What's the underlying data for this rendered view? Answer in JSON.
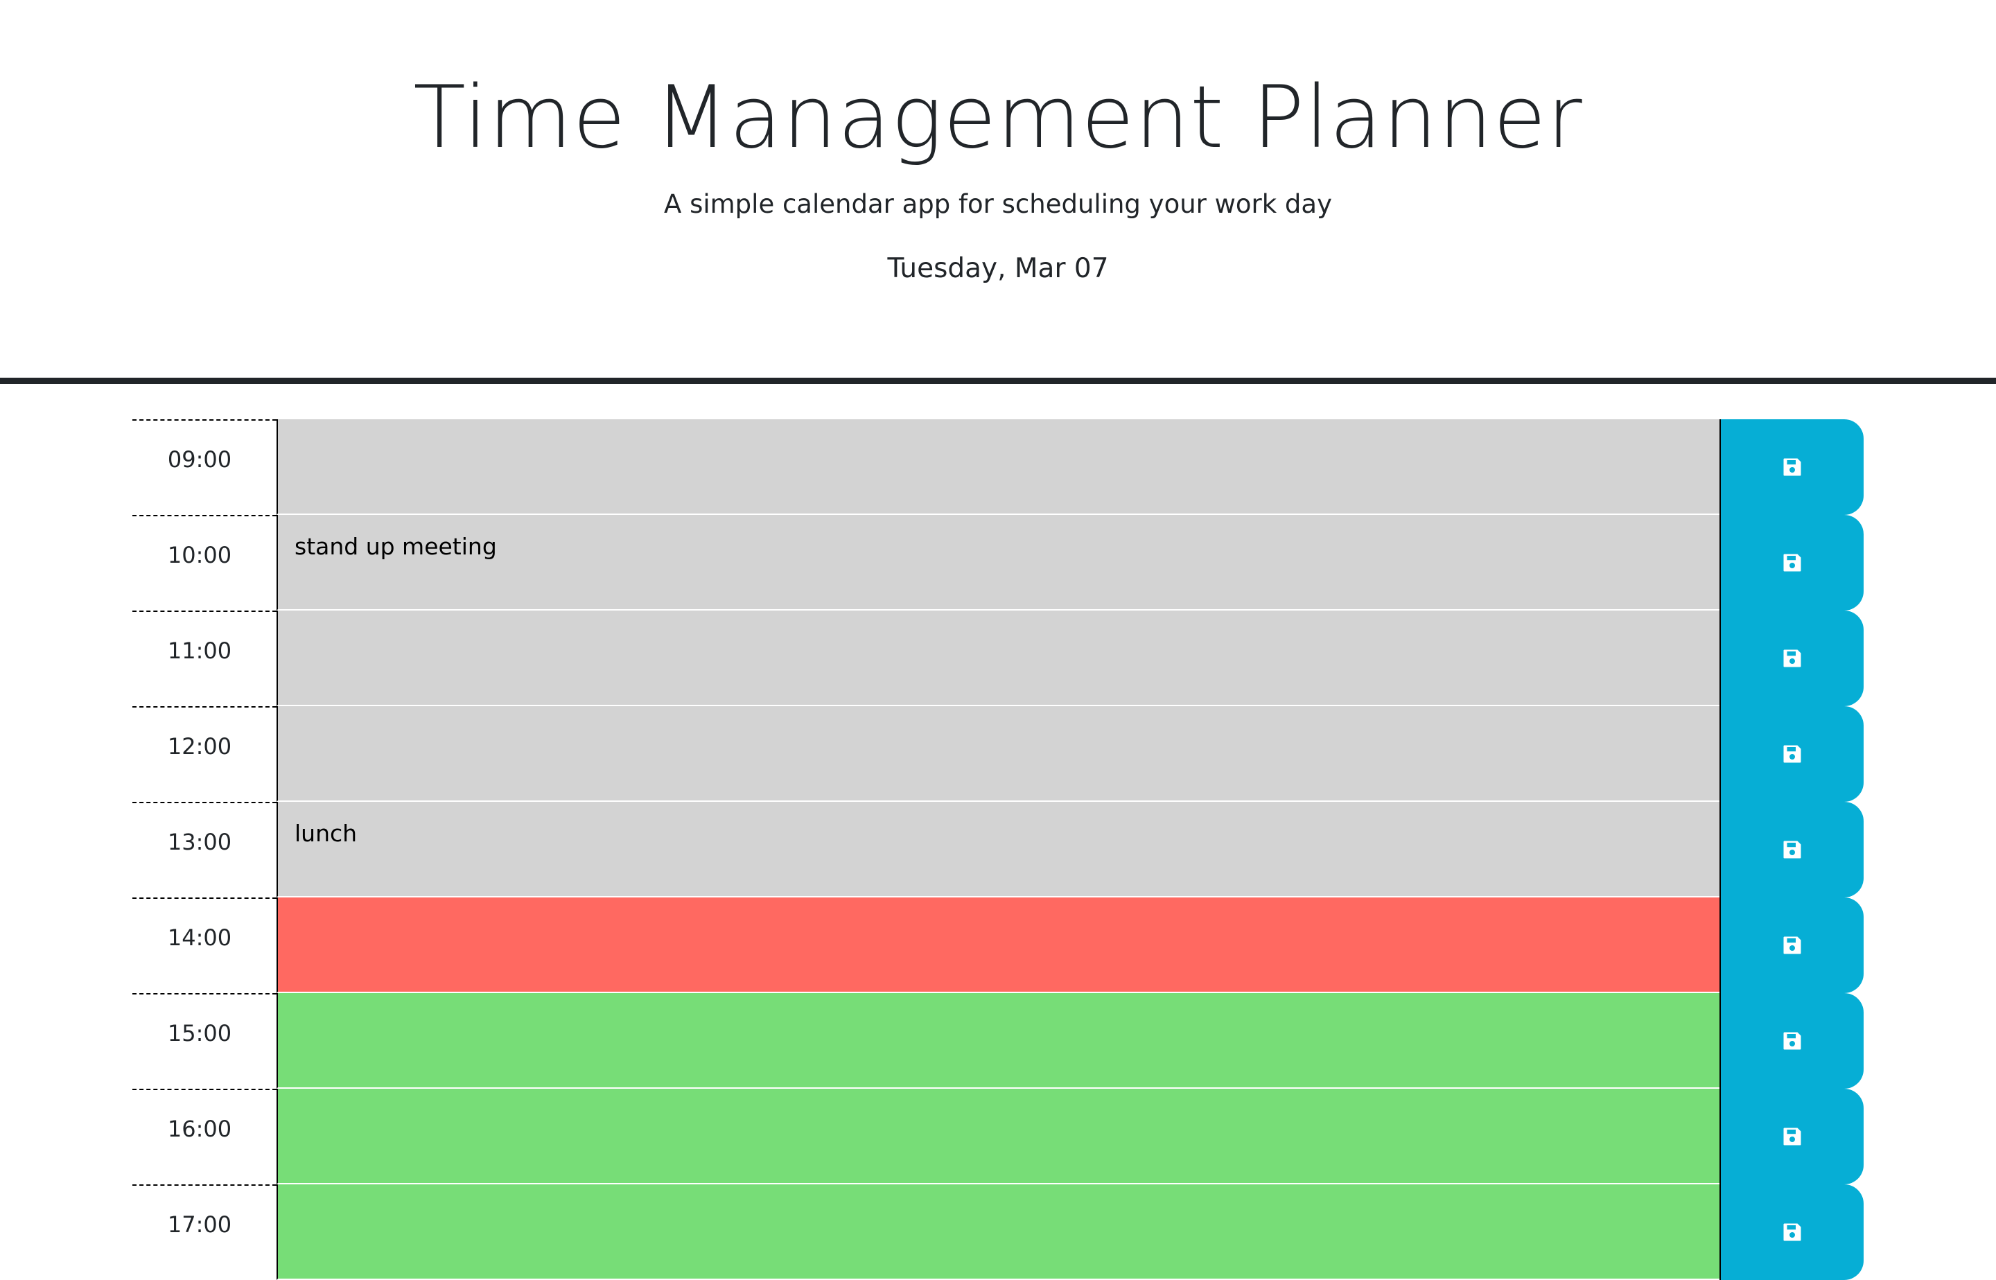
{
  "header": {
    "title": "Time Management Planner",
    "subtitle": "A simple calendar app for scheduling your work day",
    "current_day": "Tuesday, Mar 07"
  },
  "colors": {
    "past": "#d3d3d3",
    "present": "#ff6961",
    "future": "#77dd77",
    "save_button": "#06aed5"
  },
  "schedule": [
    {
      "hour": "09:00",
      "text": "",
      "state": "past",
      "icon": "save-icon"
    },
    {
      "hour": "10:00",
      "text": "stand up meeting",
      "state": "past",
      "icon": "save-icon"
    },
    {
      "hour": "11:00",
      "text": "",
      "state": "past",
      "icon": "save-icon"
    },
    {
      "hour": "12:00",
      "text": "",
      "state": "past",
      "icon": "save-icon"
    },
    {
      "hour": "13:00",
      "text": "lunch",
      "state": "past",
      "icon": "save-icon"
    },
    {
      "hour": "14:00",
      "text": "",
      "state": "present",
      "icon": "save-icon"
    },
    {
      "hour": "15:00",
      "text": "",
      "state": "future",
      "icon": "save-icon"
    },
    {
      "hour": "16:00",
      "text": "",
      "state": "future",
      "icon": "save-icon"
    },
    {
      "hour": "17:00",
      "text": "",
      "state": "future",
      "icon": "save-icon"
    }
  ]
}
